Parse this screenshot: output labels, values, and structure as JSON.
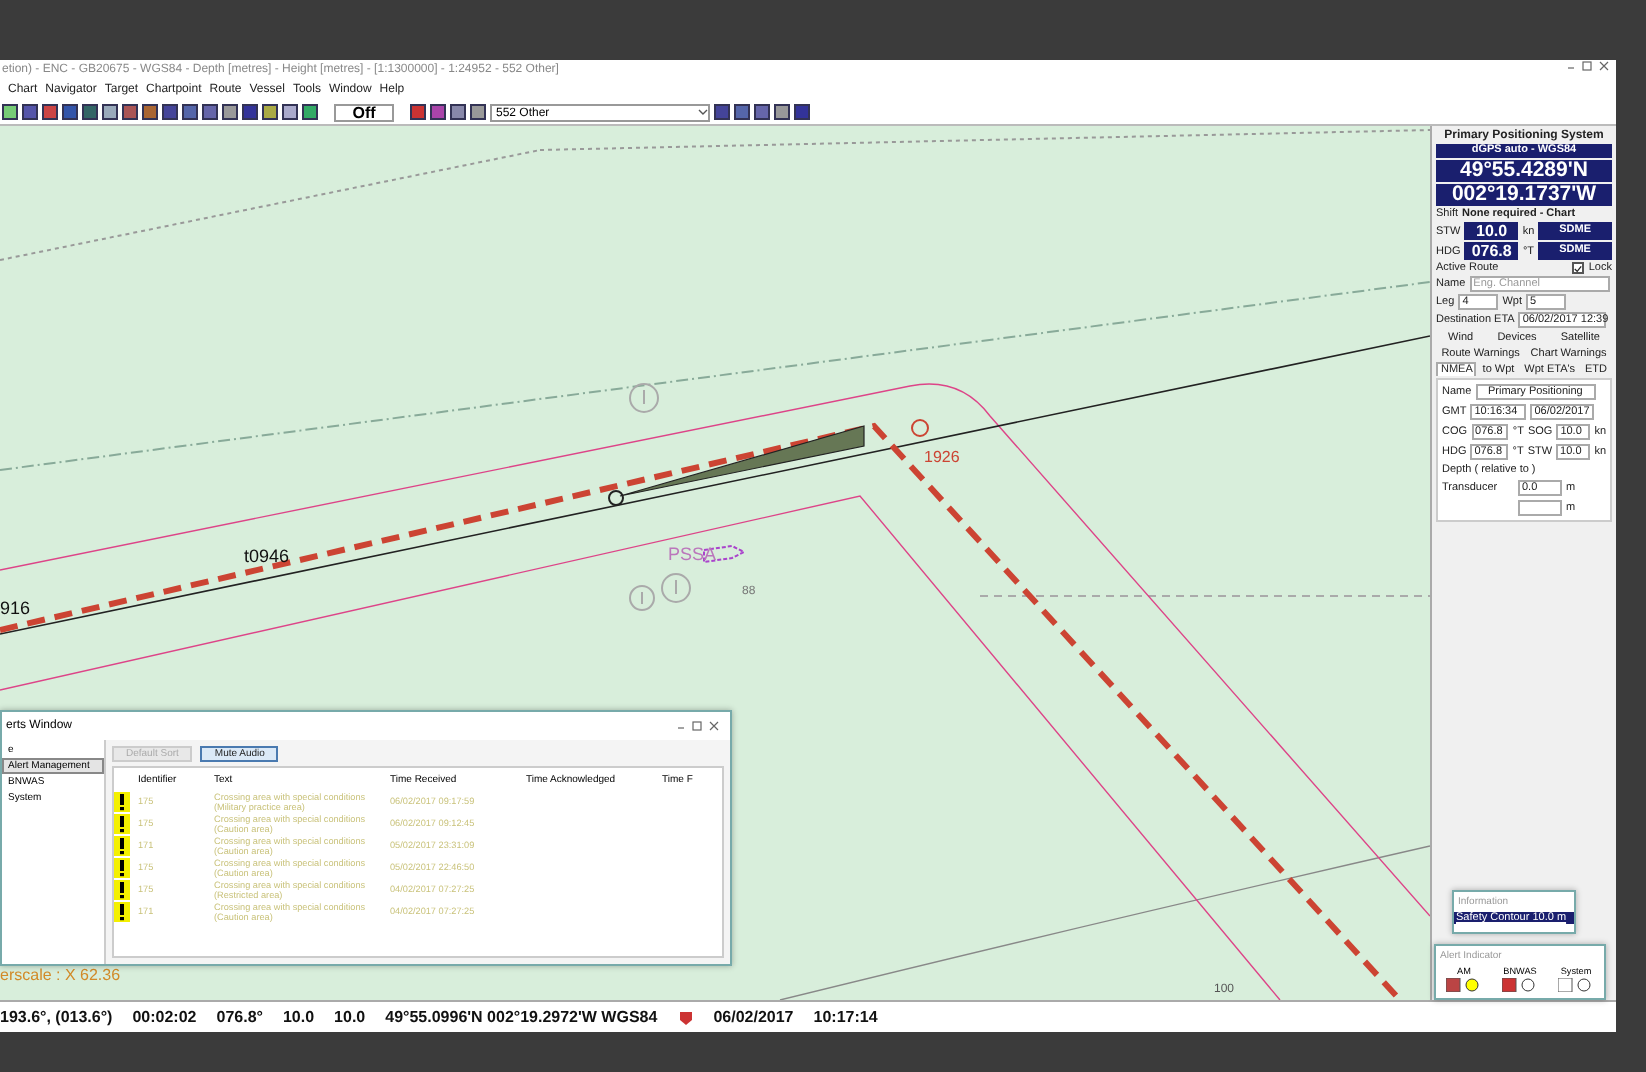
{
  "window": {
    "title": "etion) - ENC - GB20675 - WGS84 - Depth [metres] - Height [metres] - [1:1300000] - 1:24952 - 552 Other]"
  },
  "menu": [
    "Chart",
    "Navigator",
    "Target",
    "Chartpoint",
    "Route",
    "Vessel",
    "Tools",
    "Window",
    "Help"
  ],
  "toolbar": {
    "mode_value": "Off",
    "layer_select": "552 Other"
  },
  "chart": {
    "labels": [
      {
        "kind": "waypoint",
        "text": "t0946"
      },
      {
        "kind": "waypoint",
        "text": "916"
      },
      {
        "kind": "route-end",
        "text": "1926"
      },
      {
        "kind": "area",
        "text": "PSSA"
      },
      {
        "kind": "depth",
        "text": "88"
      },
      {
        "kind": "contour",
        "text": "100"
      }
    ],
    "overscale": "erscale : X 62.36"
  },
  "positioning": {
    "title": "Primary Positioning System",
    "source": "dGPS auto - WGS84",
    "latitude": "49°55.4289'N",
    "longitude": "002°19.1737'W",
    "shift_label": "Shift",
    "shift_value": "None required - Chart",
    "speeds": [
      {
        "label": "STW",
        "value": "10.0",
        "unit": "kn",
        "source": "SDME"
      },
      {
        "label": "HDG",
        "value": "076.8",
        "unit": "°T",
        "source": "SDME"
      }
    ],
    "active_route": "Active Route",
    "lock": {
      "label": "Lock",
      "checked": true
    },
    "name_label": "Name",
    "route_name": "Eng. Channel",
    "leg_label": "Leg",
    "leg": "4",
    "wpt_label": "Wpt",
    "wpt": "5",
    "eta_label": "Destination ETA",
    "eta": "06/02/2017 12:39",
    "tab_rows": [
      [
        {
          "label": "Wind",
          "selected": false
        },
        {
          "label": "Devices",
          "selected": false
        },
        {
          "label": "Satellite",
          "selected": false
        }
      ],
      [
        {
          "label": "Route Warnings",
          "selected": false
        },
        {
          "label": "Chart Warnings",
          "selected": false
        }
      ],
      [
        {
          "label": "NMEA",
          "selected": true
        },
        {
          "label": "to Wpt",
          "selected": false
        },
        {
          "label": "Wpt ETA's",
          "selected": false
        },
        {
          "label": "ETD",
          "selected": false
        }
      ]
    ],
    "nmea": {
      "name_label": "Name",
      "name": "Primary Positioning",
      "gmt_label": "GMT",
      "time": "10:16:34",
      "date": "06/02/2017",
      "rows": [
        {
          "label": "COG",
          "value": "076.8",
          "unit": "°T",
          "label2": "SOG",
          "value2": "10.0",
          "unit2": "kn"
        },
        {
          "label": "HDG",
          "value": "076.8",
          "unit": "°T",
          "label2": "STW",
          "value2": "10.0",
          "unit2": "kn"
        }
      ],
      "depth_label": "Depth ( relative to )",
      "transducer_label": "Transducer",
      "transducer": "0.0",
      "depth_unit": "m",
      "depth_unit2": "m"
    }
  },
  "alerts_window": {
    "title": "erts Window",
    "tree": [
      {
        "label": "e",
        "selected": false
      },
      {
        "label": "Alert Management",
        "selected": true
      },
      {
        "label": "BNWAS",
        "selected": false
      },
      {
        "label": "System",
        "selected": false
      }
    ],
    "buttons": [
      {
        "label": "Default Sort",
        "disabled": true
      },
      {
        "label": "Mute Audio",
        "disabled": false
      }
    ],
    "columns": [
      "Identifier",
      "Text",
      "Time Received",
      "Time Acknowledged",
      "Time F"
    ],
    "rows": [
      {
        "id": "175",
        "text": "Crossing area with special conditions (Military practice area)",
        "received": "06/02/2017 09:17:59"
      },
      {
        "id": "175",
        "text": "Crossing area with special conditions (Caution area)",
        "received": "06/02/2017 09:12:45"
      },
      {
        "id": "171",
        "text": "Crossing area with special conditions (Caution area)",
        "received": "05/02/2017 23:31:09"
      },
      {
        "id": "175",
        "text": "Crossing area with special conditions (Caution area)",
        "received": "05/02/2017 22:46:50"
      },
      {
        "id": "175",
        "text": "Crossing area with special conditions (Restricted area)",
        "received": "04/02/2017 07:27:25"
      },
      {
        "id": "171",
        "text": "Crossing area with special conditions (Caution area)",
        "received": "04/02/2017 07:27:25"
      }
    ]
  },
  "information": {
    "title": "Information",
    "message": "Safety Contour 10.0 m"
  },
  "alert_indicator": {
    "title": "Alert Indicator",
    "groups": [
      "AM",
      "BNWAS",
      "System"
    ]
  },
  "status_bar": [
    "193.6°, (013.6°)",
    "00:02:02",
    "076.8°",
    "10.0",
    "10.0",
    "49°55.0996'N 002°19.2972'W WGS84",
    "06/02/2017",
    "10:17:14"
  ]
}
